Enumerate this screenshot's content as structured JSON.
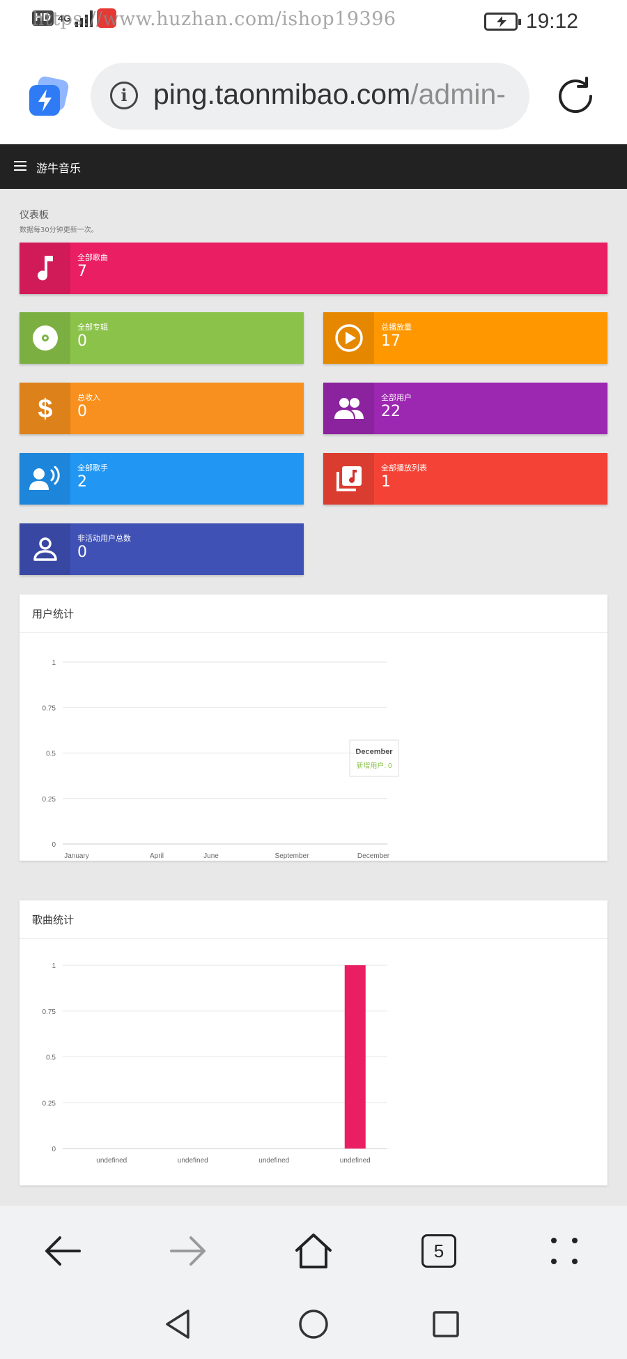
{
  "status_bar": {
    "network_chip": "HD",
    "network_type": "4G",
    "watermark": "https://www.huzhan.com/ishop19396",
    "time": "19:12"
  },
  "browser": {
    "url_host": "ping.taonmibao.com",
    "url_path": "/admin-",
    "tab_count": "5"
  },
  "app": {
    "title": "游牛音乐"
  },
  "dashboard": {
    "title": "仪表板",
    "subtitle": "数据每30分钟更新一次。"
  },
  "cards": [
    {
      "label": "全部歌曲",
      "value": "7",
      "color": "#e91e63",
      "icon": "music-note-icon"
    },
    {
      "label": "全部专辑",
      "value": "0",
      "color": "#8bc34a",
      "icon": "disc-icon"
    },
    {
      "label": "总播放量",
      "value": "17",
      "color": "#ff9800",
      "icon": "play-circle-icon"
    },
    {
      "label": "总收入",
      "value": "0",
      "color": "#f7901e",
      "icon": "dollar-icon"
    },
    {
      "label": "全部用户",
      "value": "22",
      "color": "#9c27b0",
      "icon": "users-icon"
    },
    {
      "label": "全部歌手",
      "value": "2",
      "color": "#2196f3",
      "icon": "speaking-person-icon"
    },
    {
      "label": "全部播放列表",
      "value": "1",
      "color": "#f44336",
      "icon": "playlist-icon"
    },
    {
      "label": "非活动用户总数",
      "value": "0",
      "color": "#3f51b5",
      "icon": "person-outline-icon"
    }
  ],
  "user_panel": {
    "title": "用户统计",
    "tooltip_title": "December",
    "tooltip_line": "新增用户: 0"
  },
  "song_panel": {
    "title": "歌曲统计"
  },
  "chart_data": [
    {
      "type": "line",
      "title": "用户统计",
      "x": [
        "January",
        "April",
        "June",
        "September",
        "December"
      ],
      "series": [
        {
          "name": "新增用户",
          "values": [
            0,
            0,
            0,
            0,
            0
          ],
          "color": "#8bc34a"
        }
      ],
      "yticks": [
        "0",
        "0.25",
        "0.5",
        "0.75",
        "1"
      ],
      "ylim": [
        0,
        1
      ],
      "grid": true
    },
    {
      "type": "bar",
      "title": "歌曲统计",
      "categories": [
        "undefined",
        "undefined",
        "undefined",
        "undefined"
      ],
      "values": [
        0,
        0,
        0,
        1
      ],
      "yticks": [
        "0",
        "0.25",
        "0.5",
        "0.75",
        "1"
      ],
      "ylim": [
        0,
        1
      ],
      "color": "#e91e63",
      "grid": true
    }
  ]
}
